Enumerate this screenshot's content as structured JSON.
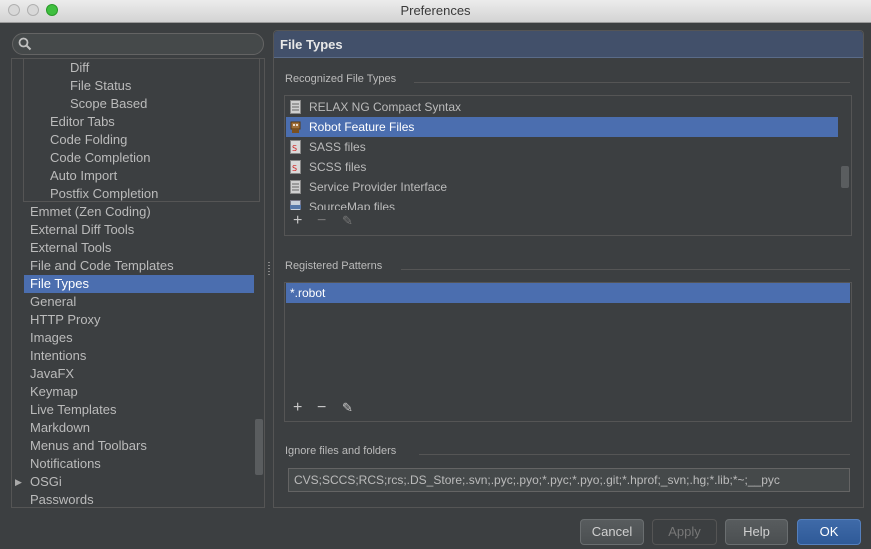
{
  "window": {
    "title": "Preferences"
  },
  "search": {
    "placeholder": ""
  },
  "tree": {
    "subitems": [
      "Diff",
      "File Status",
      "Scope Based"
    ],
    "editor_items": [
      "Editor Tabs",
      "Code Folding",
      "Code Completion",
      "Auto Import",
      "Postfix Completion"
    ],
    "items": [
      "Emmet (Zen Coding)",
      "External Diff Tools",
      "External Tools",
      "File and Code Templates",
      "File Types",
      "General",
      "HTTP Proxy",
      "Images",
      "Intentions",
      "JavaFX",
      "Keymap",
      "Live Templates",
      "Markdown",
      "Menus and Toolbars",
      "Notifications",
      "OSGi",
      "Passwords"
    ],
    "selected": "File Types"
  },
  "panel": {
    "title": "File Types",
    "recognized_label": "Recognized File Types",
    "file_types": [
      {
        "label": "RELAX NG Compact Syntax",
        "icon": "text-file-icon"
      },
      {
        "label": "Robot Feature Files",
        "icon": "robot-icon"
      },
      {
        "label": "SASS files",
        "icon": "sass-file-icon"
      },
      {
        "label": "SCSS files",
        "icon": "scss-file-icon"
      },
      {
        "label": "Service Provider Interface",
        "icon": "text-file-icon"
      },
      {
        "label": "SourceMap files",
        "icon": "json-file-icon"
      }
    ],
    "selected_file_type": "Robot Feature Files",
    "patterns_label": "Registered Patterns",
    "patterns": [
      "*.robot"
    ],
    "ignore_label": "Ignore files and folders",
    "ignore_value": "CVS;SCCS;RCS;rcs;.DS_Store;.svn;.pyc;.pyo;*.pyc;*.pyo;.git;*.hprof;_svn;.hg;*.lib;*~;__pyc"
  },
  "buttons": {
    "cancel": "Cancel",
    "apply": "Apply",
    "help": "Help",
    "ok": "OK"
  },
  "toolbar_glyphs": {
    "add": "+",
    "remove": "−",
    "edit": "✎"
  },
  "colors": {
    "selection": "#4b6eaf",
    "background": "#3c3f41",
    "header": "#42506a"
  }
}
